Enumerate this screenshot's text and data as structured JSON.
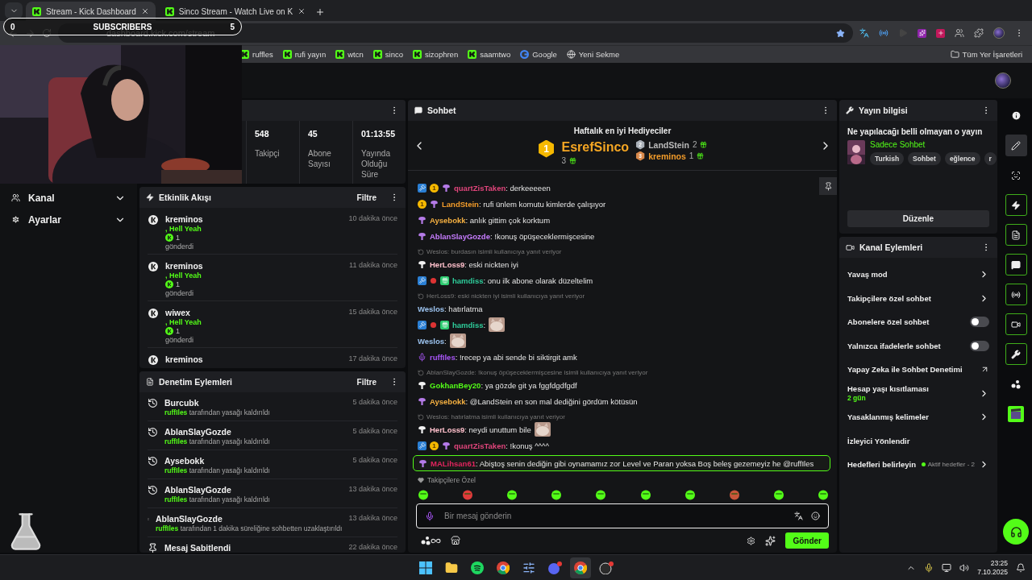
{
  "browser": {
    "tabs": [
      {
        "title": "Stream - Kick Dashboard",
        "selected": true
      },
      {
        "title": "Sinco Stream - Watch Live on K",
        "selected": false
      }
    ],
    "url": "dashboard.kick.com/stream",
    "bookmarks": [
      {
        "label": "ruffles",
        "kind": "kick"
      },
      {
        "label": "rufi yayın",
        "kind": "kick"
      },
      {
        "label": "wtcn",
        "kind": "kick"
      },
      {
        "label": "sinco",
        "kind": "kick"
      },
      {
        "label": "sizophren",
        "kind": "kick"
      },
      {
        "label": "saamtwo",
        "kind": "kick"
      },
      {
        "label": "Google",
        "kind": "google"
      },
      {
        "label": "Yeni Sekme",
        "kind": "globe"
      }
    ],
    "all_bookmarks": "Tüm Yer İşaretleri"
  },
  "stream_overlay": {
    "start": "0",
    "label": "SUBSCRIBERS",
    "goal": "5",
    "level": 0
  },
  "sidebar": {
    "items": [
      {
        "label": "Kanal",
        "kind": "channel"
      },
      {
        "label": "Ayarlar",
        "kind": "settings"
      }
    ]
  },
  "stats": [
    {
      "value": "548",
      "label": "Takipçi"
    },
    {
      "value": "45",
      "label": "Abone Sayısı"
    },
    {
      "value": "01:13:55",
      "label": "Yayında Olduğu Süre"
    }
  ],
  "activity": {
    "title": "Etkinlik Akışı",
    "filter": "Filtre",
    "events": [
      {
        "user": "kreminos",
        "reward": ", Hell Yeah",
        "amount": "1",
        "action": "gönderdi",
        "time": "10 dakika önce"
      },
      {
        "user": "kreminos",
        "reward": ", Hell Yeah",
        "amount": "1",
        "action": "gönderdi",
        "time": "11 dakika önce"
      },
      {
        "user": "wiwex",
        "reward": ", Hell Yeah",
        "amount": "1",
        "action": "gönderdi",
        "time": "15 dakika önce"
      },
      {
        "user": "kreminos",
        "time": "17 dakika önce"
      }
    ]
  },
  "moderation": {
    "title": "Denetim Eylemleri",
    "filter": "Filtre",
    "actions": [
      {
        "kind": "unban",
        "target": "Burcubk",
        "moderator": "ruffIles",
        "text": "tarafından yasağı kaldırıldı",
        "time": "5 dakika önce"
      },
      {
        "kind": "unban",
        "target": "AblanSlayGozde",
        "moderator": "ruffIles",
        "text": "tarafından yasağı kaldırıldı",
        "time": "5 dakika önce"
      },
      {
        "kind": "unban",
        "target": "Aysebokk",
        "moderator": "ruffIles",
        "text": "tarafından yasağı kaldırıldı",
        "time": "5 dakika önce"
      },
      {
        "kind": "unban",
        "target": "AblanSlayGozde",
        "moderator": "ruffIles",
        "text": "tarafından yasağı kaldırıldı",
        "time": "13 dakika önce"
      },
      {
        "kind": "timeout",
        "target": "AblanSlayGozde",
        "moderator": "ruffIles",
        "text": "tarafından 1 dakika süreliğine sohbetten uzaklaştırıldı",
        "time": "13 dakika önce"
      },
      {
        "kind": "pin",
        "target": "Mesaj Sabitlendi",
        "time": "22 dakika önce"
      }
    ]
  },
  "chat": {
    "title": "Sohbet",
    "gifters": {
      "title": "Haftalık en iyi Hediyeciler",
      "entries": [
        {
          "rank": "1",
          "name": "EsrefSinco",
          "count": "3"
        },
        {
          "rank": "2",
          "name": "LandStein",
          "count": "2"
        },
        {
          "rank": "3",
          "name": "kreminos",
          "count": "1"
        }
      ]
    },
    "messages": [
      {
        "kind": "message",
        "badges": [
          {
            "kind": "mod"
          },
          {
            "kind": "gifter",
            "label": "1"
          },
          {
            "kind": "sub"
          }
        ],
        "user": "quartZisTaken",
        "color": "#e0457b",
        "text": ": derkeeeeen"
      },
      {
        "kind": "message",
        "badges": [
          {
            "kind": "gifter",
            "label": "1"
          },
          {
            "kind": "sub"
          }
        ],
        "user": "LandStein",
        "color": "#f39c2a",
        "text": ": rufi ünlem komutu kimlerde çalışıyor"
      },
      {
        "kind": "message",
        "badges": [
          {
            "kind": "sub"
          }
        ],
        "user": "Aysebokk",
        "color": "#f5b041",
        "text": ": anlık gittim çok korktum"
      },
      {
        "kind": "message",
        "badges": [
          {
            "kind": "sub"
          }
        ],
        "user": "AblanSlayGozde",
        "color": "#c77dff",
        "text": ": !konuş öpüşeceklermişcesine"
      },
      {
        "kind": "reply",
        "text": "Weslos: burdasın isimli kullanıcıya yanıt veriyor"
      },
      {
        "kind": "message",
        "badges": [
          {
            "kind": "og"
          }
        ],
        "user": "HerLoss9",
        "color": "#ffc0cb",
        "text": ": eski nickten iyi"
      },
      {
        "kind": "message",
        "badges": [
          {
            "kind": "mod"
          },
          {
            "kind": "vip"
          },
          {
            "kind": "gift"
          }
        ],
        "user": "hamdiss",
        "color": "#2ecc9a",
        "text": ": onu ilk abone olarak düzeltelim"
      },
      {
        "kind": "reply",
        "text": "HerLoss9: eski nickten iyi isimli kullanıcıya yanıt veriyor"
      },
      {
        "kind": "message",
        "user": "Weslos",
        "color": "#9cc3ef",
        "text": ": hatırlatma"
      },
      {
        "kind": "message",
        "badges": [
          {
            "kind": "mod"
          },
          {
            "kind": "vip"
          },
          {
            "kind": "gift"
          }
        ],
        "user": "hamdiss",
        "color": "#2ecc9a",
        "text": ":",
        "emote": true
      },
      {
        "kind": "message",
        "user": "Weslos",
        "color": "#9cc3ef",
        "text": ":",
        "emote": true
      },
      {
        "kind": "message",
        "badges": [
          {
            "kind": "mic"
          }
        ],
        "user": "ruffIles",
        "color": "#a855f7",
        "text": ": !recep ya abi sende bi siktirgit amk"
      },
      {
        "kind": "reply",
        "text": "AblanSlayGozde: !konuş öpüşeceklermişcesine isimli kullanıcıya yanıt veriyor"
      },
      {
        "kind": "message",
        "badges": [
          {
            "kind": "og"
          }
        ],
        "user": "GokhanBey20",
        "color": "#53fc18",
        "text": ": ya gözde git ya fggfdgdfgdf"
      },
      {
        "kind": "message",
        "badges": [
          {
            "kind": "sub"
          }
        ],
        "user": "Aysebokk",
        "color": "#f5b041",
        "text": ": @LandStein en son mal dediğini gördüm kötüsün"
      },
      {
        "kind": "reply",
        "text": "Weslos: hatırlatma isimli kullanıcıya yanıt veriyor"
      },
      {
        "kind": "message",
        "badges": [
          {
            "kind": "og"
          }
        ],
        "user": "HerLoss9",
        "color": "#ffc0cb",
        "text": ": neydi unuttum bile",
        "emote": true
      },
      {
        "kind": "message",
        "badges": [
          {
            "kind": "mod"
          },
          {
            "kind": "gifter",
            "label": "1"
          },
          {
            "kind": "sub"
          }
        ],
        "user": "quartZisTaken",
        "color": "#e0457b",
        "text": ": !konuş ^^^^"
      },
      {
        "kind": "message",
        "badges": [
          {
            "kind": "sub"
          }
        ],
        "user": "MALihsan61",
        "color": "#e0245e",
        "text": ": Abiştoş senin dediğin gibi oynamamız zor Level ve Paran yoksa Boş beleş gezemeyiz he @ruffIles",
        "highlighted": true
      }
    ],
    "emote_section": "Takipçilere Özel",
    "input": {
      "placeholder": "Bir mesaj gönderin"
    },
    "send": "Gönder"
  },
  "stream_info": {
    "title": "Yayın bilgisi",
    "stream_title": "Ne yapılacağı belli olmayan o yayın",
    "category": "Sadece Sohbet",
    "tags": [
      "Turkish",
      "Sohbet",
      "eğlence",
      "r"
    ],
    "edit": "Düzenle"
  },
  "channel_actions": {
    "title": "Kanal Eylemleri",
    "items": [
      {
        "kind": "arrow",
        "label": "Yavaş mod"
      },
      {
        "kind": "arrow",
        "label": "Takipçilere özel sohbet"
      },
      {
        "kind": "toggle",
        "label": "Abonelere özel sohbet",
        "on": false
      },
      {
        "kind": "toggle",
        "label": "Yalnızca ifadelerle sohbet",
        "on": false
      },
      {
        "kind": "external",
        "label": "Yapay Zeka ile Sohbet Denetimi"
      },
      {
        "kind": "arrow",
        "label": "Hesap yaşı kısıtlaması",
        "detail": "2 gün"
      },
      {
        "kind": "arrow",
        "label": "Yasaklanmış kelimeler"
      },
      {
        "kind": "plain",
        "label": "İzleyici Yönlendir"
      },
      {
        "kind": "arrow",
        "label": "Hedefleri belirleyin",
        "status": "Aktif hedefler - 2"
      }
    ]
  },
  "rail": [
    {
      "kind": "info",
      "selected": false,
      "active": false
    },
    {
      "kind": "edit",
      "selected": true,
      "active": false
    },
    {
      "kind": "capture",
      "selected": false,
      "active": false
    },
    {
      "kind": "bolt",
      "selected": false,
      "active": true
    },
    {
      "kind": "log",
      "selected": false,
      "active": true
    },
    {
      "kind": "chat",
      "selected": false,
      "active": true
    },
    {
      "kind": "broadcast",
      "selected": false,
      "active": true
    },
    {
      "kind": "camera",
      "selected": false,
      "active": true
    },
    {
      "kind": "wrench",
      "selected": false,
      "active": true
    },
    {
      "kind": "dots",
      "selected": false,
      "active": false
    },
    {
      "kind": "clapper",
      "selected": false,
      "active": false
    }
  ],
  "taskbar": {
    "apps": [
      {
        "kind": "start",
        "selected": false
      },
      {
        "kind": "files",
        "selected": false
      },
      {
        "kind": "spotify",
        "selected": false
      },
      {
        "kind": "chrome",
        "selected": false
      },
      {
        "kind": "tool",
        "selected": false
      },
      {
        "kind": "discord",
        "selected": false
      },
      {
        "kind": "chrome",
        "selected": true
      },
      {
        "kind": "obs",
        "selected": false
      }
    ],
    "time": "23:25",
    "date": "7.10.2025"
  }
}
